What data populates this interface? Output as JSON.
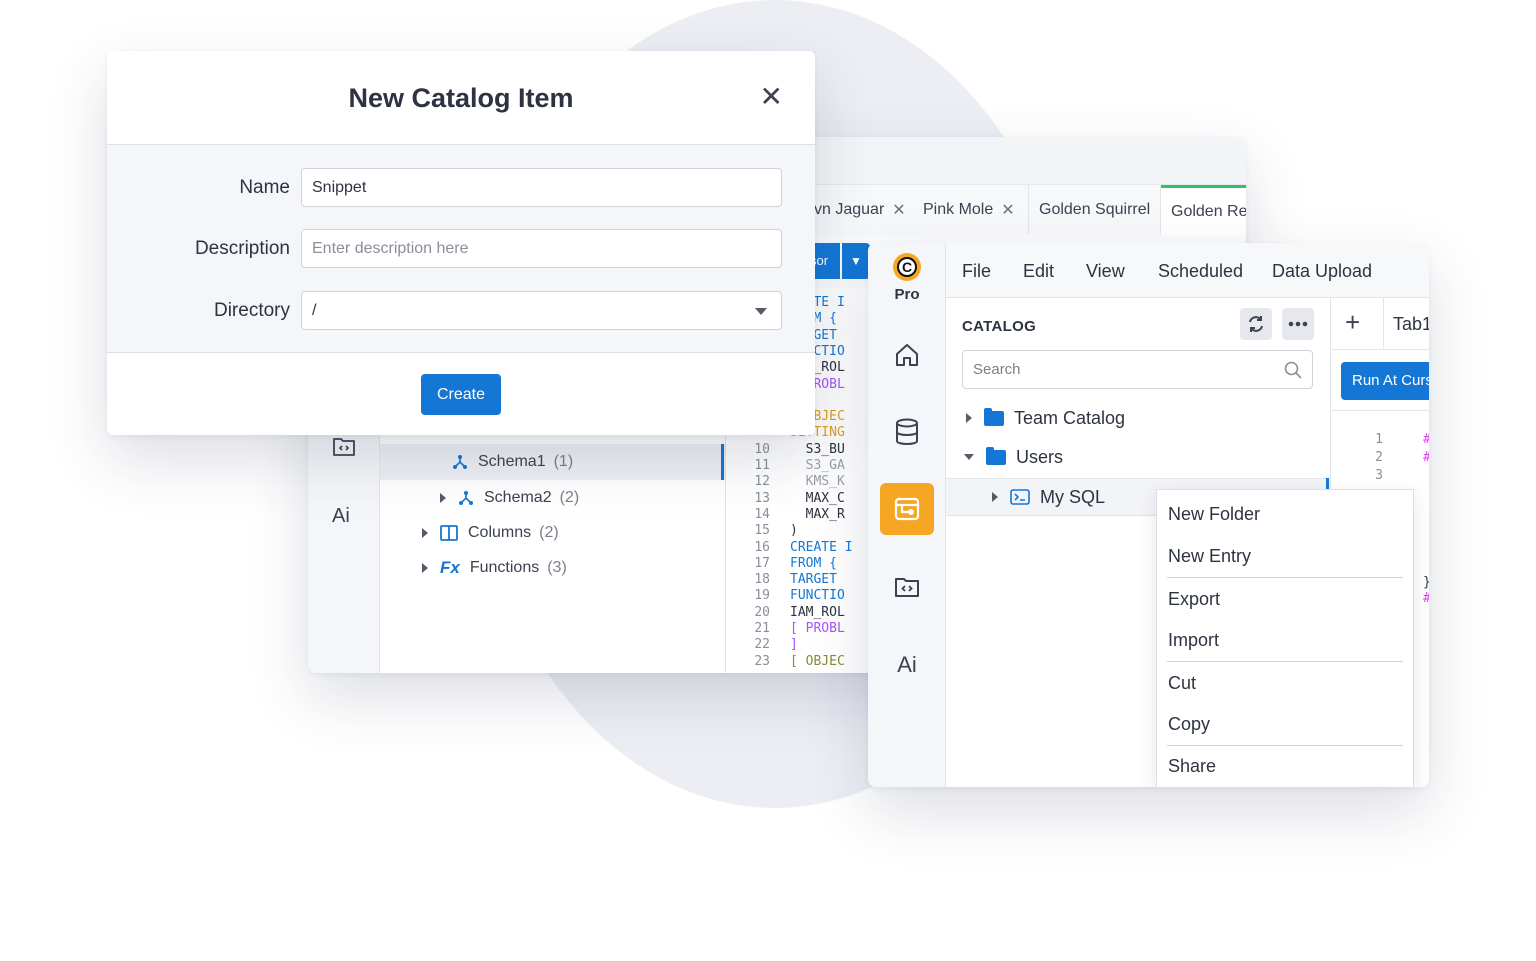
{
  "modal": {
    "title": "New Catalog Item",
    "close_icon": "close-icon",
    "name_label": "Name",
    "name_value": "Snippet",
    "description_label": "Description",
    "description_placeholder": "Enter description here",
    "directory_label": "Directory",
    "directory_value": "/",
    "create_label": "Create"
  },
  "back_window": {
    "tabs": [
      {
        "label": "vn Jaguar",
        "closable": true
      },
      {
        "label": "Pink Mole",
        "closable": true
      },
      {
        "label": "Golden Squirrel",
        "closable": false
      },
      {
        "label": "Golden Re",
        "closable": false
      }
    ],
    "run_label": "sor",
    "rail_label": "Ai",
    "tree": [
      {
        "label": "Schema1",
        "count": "(1)",
        "icon": "schema-icon"
      },
      {
        "label": "Schema2",
        "count": "(2)",
        "icon": "schema-icon"
      },
      {
        "label": "Columns",
        "count": "(2)",
        "icon": "columns-icon"
      },
      {
        "label": "Functions",
        "count": "(3)",
        "icon": "function-icon",
        "icon_text": "Fx"
      }
    ],
    "code": [
      {
        "n": "",
        "t": "REATE I",
        "c": "#1477d6"
      },
      {
        "n": "",
        "t": "FROM {",
        "c": "#1477d6"
      },
      {
        "n": "",
        "t": "TARGET",
        "c": "#1477d6"
      },
      {
        "n": "",
        "t": "FUNCTIO",
        "c": "#1477d6"
      },
      {
        "n": "",
        "t": "IAM_ROL",
        "c": "#2d3340"
      },
      {
        "n": "",
        "t": "  PROBL",
        "c": "#a855f7"
      },
      {
        "n": "",
        "t": "",
        "c": "#2d3340"
      },
      {
        "n": "",
        "t": "  OBJEC",
        "c": "#e0a01d"
      },
      {
        "n": "",
        "t": "SETTING",
        "c": "#e0a01d"
      },
      {
        "n": "10",
        "t": "  S3_BU",
        "c": "#2d3340"
      },
      {
        "n": "11",
        "t": "  S3_GA",
        "c": "#9aa0aa"
      },
      {
        "n": "12",
        "t": "  KMS_K",
        "c": "#9aa0aa"
      },
      {
        "n": "13",
        "t": "  MAX_C",
        "c": "#2d3340"
      },
      {
        "n": "14",
        "t": "  MAX_R",
        "c": "#2d3340"
      },
      {
        "n": "15",
        "t": ")",
        "c": "#2d3340"
      },
      {
        "n": "16",
        "t": "CREATE I",
        "c": "#1477d6"
      },
      {
        "n": "17",
        "t": "FROM {",
        "c": "#1477d6"
      },
      {
        "n": "18",
        "t": "TARGET",
        "c": "#1477d6"
      },
      {
        "n": "19",
        "t": "FUNCTIO",
        "c": "#1477d6"
      },
      {
        "n": "20",
        "t": "IAM_ROL",
        "c": "#2d3340"
      },
      {
        "n": "21",
        "t": "[ PROBL",
        "c": "#a855f7"
      },
      {
        "n": "22",
        "t": "]",
        "c": "#a855f7"
      },
      {
        "n": "23",
        "t": "[ OBJEC",
        "c": "#8a8a3a"
      }
    ]
  },
  "front_window": {
    "logo_letter": "C",
    "logo_label": "Pro",
    "ai_label": "Ai",
    "menu": [
      "File",
      "Edit",
      "View",
      "Scheduled",
      "Data Upload"
    ],
    "catalog_title": "CATALOG",
    "search_placeholder": "Search",
    "tree": [
      {
        "label": "Team Catalog"
      },
      {
        "label": "Users"
      },
      {
        "label": "My SQL"
      }
    ],
    "editor_tab": "Tab1",
    "run_label": "Run At Curs",
    "line_numbers": [
      "1",
      "2",
      "3"
    ],
    "context_menu": [
      "New Folder",
      "New Entry",
      "Export",
      "Import",
      "Cut",
      "Copy",
      "Share"
    ]
  },
  "colors": {
    "accent": "#1477d6",
    "active_nav": "#f5a623",
    "active_tab": "#2fc26b"
  }
}
